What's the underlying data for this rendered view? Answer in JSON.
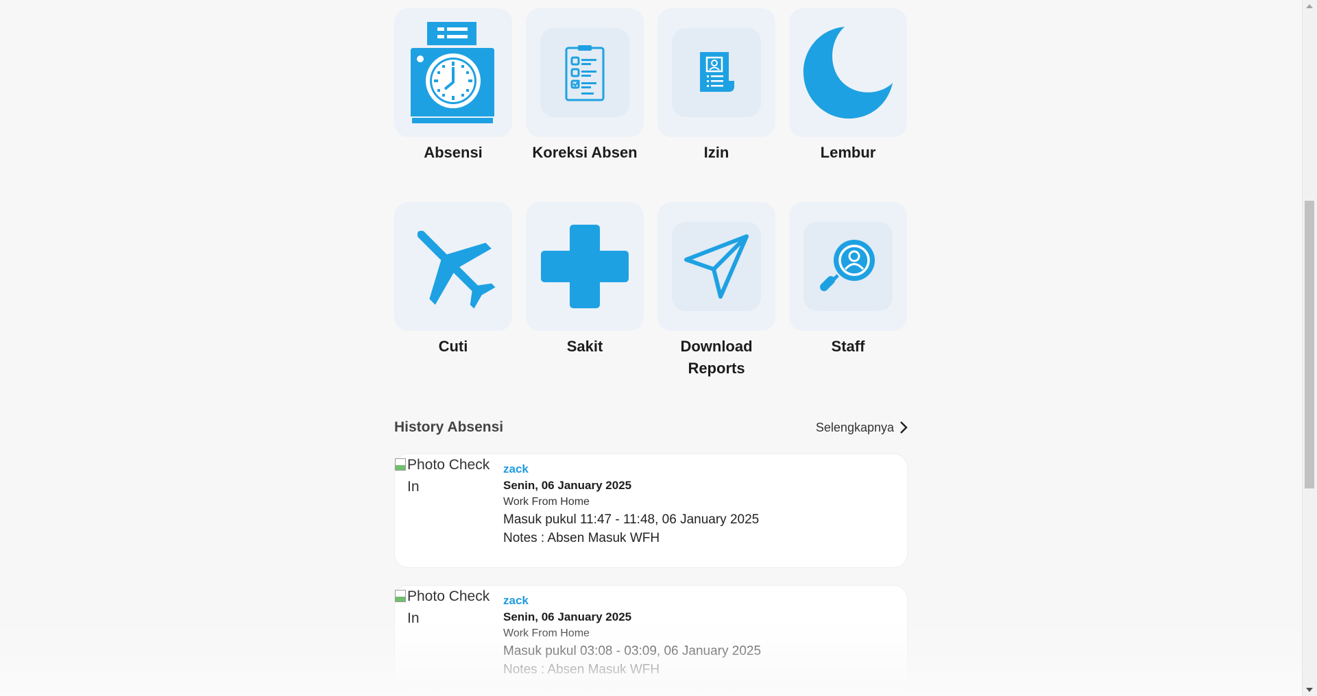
{
  "menu": [
    {
      "label": "Absensi",
      "icon": "time-clock-icon"
    },
    {
      "label": "Koreksi Absen",
      "icon": "clipboard-checklist-icon"
    },
    {
      "label": "Izin",
      "icon": "permit-document-icon"
    },
    {
      "label": "Lembur",
      "icon": "moon-icon"
    },
    {
      "label": "Cuti",
      "icon": "airplane-icon"
    },
    {
      "label": "Sakit",
      "icon": "medical-cross-icon"
    },
    {
      "label": "Download Reports",
      "icon": "paper-plane-icon"
    },
    {
      "label": "Staff",
      "icon": "user-search-icon"
    }
  ],
  "history": {
    "title": "History Absensi",
    "see_more": "Selengkapnya",
    "records": [
      {
        "photo_alt": "Photo Check In",
        "user": "zack",
        "date": "Senin, 06 January 2025",
        "type": "Work From Home",
        "time": "Masuk pukul 11:47 - 11:48, 06 January 2025",
        "notes": "Notes : Absen Masuk WFH"
      },
      {
        "photo_alt": "Photo Check In",
        "user": "zack",
        "date": "Senin, 06 January 2025",
        "type": "Work From Home",
        "time": "Masuk pukul 03:08 - 03:09, 06 January 2025",
        "notes": "Notes : Absen Masuk WFH"
      }
    ]
  },
  "colors": {
    "accent": "#1ea1e2",
    "tile_bg": "#edf2f8",
    "user_link": "#1e9be0"
  }
}
